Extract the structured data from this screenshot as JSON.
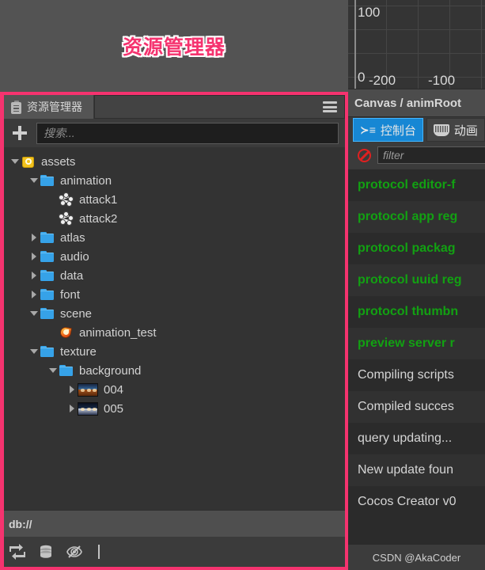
{
  "annotation": {
    "label": "资源管理器"
  },
  "explorer": {
    "tab": {
      "label": "资源管理器",
      "icon": "clipboard-icon"
    },
    "menu_icon": "hamburger-menu-icon",
    "add_button_icon": "plus-icon",
    "search": {
      "value": "",
      "placeholder": "搜索..."
    },
    "tree": [
      {
        "label": "assets",
        "indent": 0,
        "arrow": "down",
        "icon": "assets-icon"
      },
      {
        "label": "animation",
        "indent": 1,
        "arrow": "down",
        "icon": "folder-icon"
      },
      {
        "label": "attack1",
        "indent": 2,
        "arrow": "none",
        "icon": "animation-clip-icon"
      },
      {
        "label": "attack2",
        "indent": 2,
        "arrow": "none",
        "icon": "animation-clip-icon"
      },
      {
        "label": "atlas",
        "indent": 1,
        "arrow": "right",
        "icon": "folder-icon"
      },
      {
        "label": "audio",
        "indent": 1,
        "arrow": "right",
        "icon": "folder-icon"
      },
      {
        "label": "data",
        "indent": 1,
        "arrow": "right",
        "icon": "folder-icon"
      },
      {
        "label": "font",
        "indent": 1,
        "arrow": "right",
        "icon": "folder-icon"
      },
      {
        "label": "scene",
        "indent": 1,
        "arrow": "down",
        "icon": "folder-icon"
      },
      {
        "label": "animation_test",
        "indent": 2,
        "arrow": "none",
        "icon": "scene-icon"
      },
      {
        "label": "texture",
        "indent": 1,
        "arrow": "down",
        "icon": "folder-icon"
      },
      {
        "label": "background",
        "indent": 2,
        "arrow": "down",
        "icon": "folder-icon"
      },
      {
        "label": "004",
        "indent": 3,
        "arrow": "right",
        "icon": "texture-thumbnail-icon"
      },
      {
        "label": "005",
        "indent": 3,
        "arrow": "right",
        "icon": "texture-thumbnail-night-icon"
      }
    ],
    "path": "db://",
    "status_icons": [
      "sync-icon",
      "database-icon",
      "eye-off-icon"
    ]
  },
  "chart_data": {
    "type": "scatter",
    "title": "",
    "xlabel": "",
    "ylabel": "",
    "xticks": [
      "-200",
      "-100"
    ],
    "yticks": [
      "100",
      "0"
    ],
    "xlim": [
      -260,
      -40
    ],
    "ylim": [
      -10,
      130
    ],
    "grid": true,
    "series": []
  },
  "node_path": {
    "label": "Canvas / animRoot"
  },
  "console": {
    "tabs": [
      {
        "label": "控制台",
        "icon": "console-icon",
        "active": true
      },
      {
        "label": "动画",
        "icon": "animation-editor-icon",
        "active": false
      }
    ],
    "clear_icon": "clear-console-icon",
    "filter": {
      "value": "",
      "placeholder": "filter"
    },
    "logs": [
      {
        "text": "protocol editor-f",
        "level": "info"
      },
      {
        "text": "protocol app reg",
        "level": "info"
      },
      {
        "text": "protocol packag",
        "level": "info"
      },
      {
        "text": "protocol uuid reg",
        "level": "info"
      },
      {
        "text": "protocol thumbn",
        "level": "info"
      },
      {
        "text": "preview server r",
        "level": "info"
      },
      {
        "text": "Compiling scripts",
        "level": "log"
      },
      {
        "text": "Compiled succes",
        "level": "log"
      },
      {
        "text": "query updating...",
        "level": "log"
      },
      {
        "text": "New update foun",
        "level": "log"
      },
      {
        "text": "Cocos Creator v0",
        "level": "log"
      }
    ]
  },
  "watermark": {
    "text": "CSDN @AkaCoder"
  }
}
